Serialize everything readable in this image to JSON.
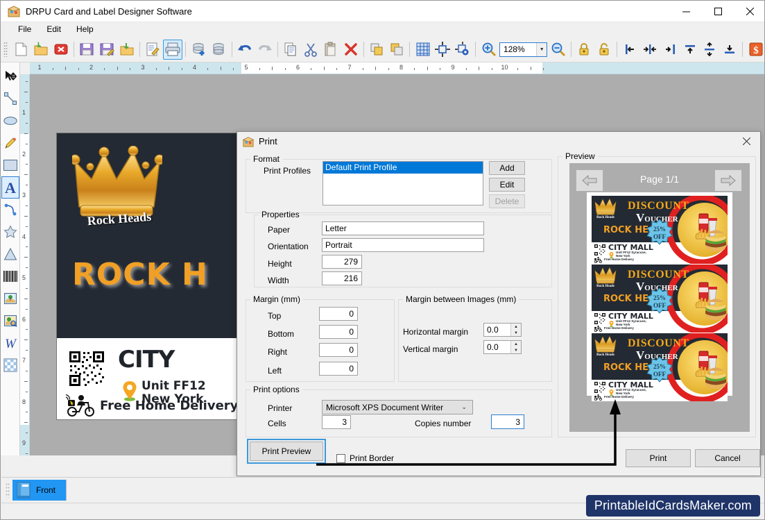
{
  "window": {
    "title": "DRPU Card and Label Designer Software",
    "app_icon": "card-designer-icon",
    "minimize": "—",
    "maximize": "☐",
    "close": "✕"
  },
  "menu": {
    "items": [
      {
        "label": "File",
        "mnemonic": "F"
      },
      {
        "label": "Edit",
        "mnemonic": "E"
      },
      {
        "label": "Help",
        "mnemonic": "H"
      }
    ]
  },
  "toolbar": {
    "zoom_value": "128%",
    "buttons": [
      {
        "name": "new-document-icon"
      },
      {
        "name": "open-folder-icon"
      },
      {
        "name": "close-document-icon"
      },
      {
        "name": "save-icon"
      },
      {
        "name": "save-as-icon"
      },
      {
        "name": "export-folder-icon"
      },
      {
        "name": "edit-document-icon"
      },
      {
        "name": "print-icon",
        "selected": true
      },
      {
        "name": "database-add-icon"
      },
      {
        "name": "database-icon"
      },
      {
        "name": "undo-icon"
      },
      {
        "name": "redo-icon"
      },
      {
        "name": "copy-icon"
      },
      {
        "name": "cut-icon"
      },
      {
        "name": "paste-icon"
      },
      {
        "name": "delete-icon"
      },
      {
        "name": "bring-to-front-icon"
      },
      {
        "name": "send-to-back-icon"
      },
      {
        "name": "grid-icon"
      },
      {
        "name": "align-center-object-icon"
      },
      {
        "name": "object-settings-icon"
      },
      {
        "name": "zoom-in-icon"
      },
      {
        "name": "zoom-out-icon"
      },
      {
        "name": "lock-icon"
      },
      {
        "name": "unlock-icon"
      },
      {
        "name": "align-left-icon"
      },
      {
        "name": "align-horizontal-center-icon"
      },
      {
        "name": "align-right-icon"
      },
      {
        "name": "align-top-icon"
      },
      {
        "name": "align-vertical-center-icon"
      },
      {
        "name": "align-bottom-icon"
      },
      {
        "name": "currency-icon"
      }
    ]
  },
  "left_tools": [
    {
      "name": "select-tool",
      "icon": "arrow-move-icon"
    },
    {
      "name": "line-tool",
      "icon": "line-icon"
    },
    {
      "name": "ellipse-tool",
      "icon": "ellipse-icon"
    },
    {
      "name": "pencil-tool",
      "icon": "pencil-icon"
    },
    {
      "name": "rectangle-tool",
      "icon": "rectangle-icon"
    },
    {
      "name": "text-tool",
      "icon": "text-a-icon",
      "selected": true
    },
    {
      "name": "curve-text-tool",
      "icon": "curve-text-icon"
    },
    {
      "name": "star-tool",
      "icon": "star-icon"
    },
    {
      "name": "triangle-tool",
      "icon": "triangle-icon"
    },
    {
      "name": "barcode-tool",
      "icon": "barcode-icon"
    },
    {
      "name": "image-tool",
      "icon": "picture-icon"
    },
    {
      "name": "image-browse-tool",
      "icon": "picture-search-icon"
    },
    {
      "name": "watermark-tool",
      "icon": "letter-w-icon"
    },
    {
      "name": "background-tool",
      "icon": "checker-icon"
    }
  ],
  "rulers": {
    "horizontal_labels": [
      "1",
      "2",
      "3",
      "4",
      "5",
      "6",
      "7",
      "8",
      "9",
      "10"
    ],
    "vertical_labels": [
      "1",
      "2",
      "3",
      "4",
      "5",
      "6",
      "7",
      "8",
      "9"
    ]
  },
  "canvas_card": {
    "logo_text": "Rock Heads",
    "headline": "ROCK H",
    "city": "CITY",
    "address_line1": "Unit FF12",
    "address_line2": "New York",
    "delivery": "Free Home Delivery"
  },
  "dialog": {
    "title": "Print",
    "icon": "print-dialog-icon",
    "close": "✕",
    "format": {
      "legend": "Format",
      "print_profiles_label": "Print Profiles",
      "profiles": [
        "Default Print Profile"
      ],
      "selected_profile": "Default Print Profile",
      "add_label": "Add",
      "edit_label": "Edit",
      "delete_label": "Delete"
    },
    "properties": {
      "legend": "Properties",
      "paper_label": "Paper",
      "paper_value": "Letter",
      "orientation_label": "Orientation",
      "orientation_value": "Portrait",
      "height_label": "Height",
      "height_value": "279",
      "width_label": "Width",
      "width_value": "216"
    },
    "margin": {
      "legend": "Margin (mm)",
      "top_label": "Top",
      "top_value": "0",
      "bottom_label": "Bottom",
      "bottom_value": "0",
      "right_label": "Right",
      "right_value": "0",
      "left_label": "Left",
      "left_value": "0"
    },
    "margin_images": {
      "legend": "Margin between Images (mm)",
      "horizontal_label": "Horizontal margin",
      "horizontal_value": "0.0",
      "vertical_label": "Vertical margin",
      "vertical_value": "0.0"
    },
    "print_options": {
      "legend": "Print options",
      "printer_label": "Printer",
      "printer_value": "Microsoft XPS Document Writer",
      "cells_label": "Cells",
      "cells_value": "3",
      "copies_label": "Copies number",
      "copies_value": "3"
    },
    "print_preview_label": "Print Preview",
    "print_border_label": "Print Border",
    "print_border_checked": false,
    "preview": {
      "legend": "Preview",
      "page_label": "Page 1/1",
      "prev_icon": "arrow-left-icon",
      "next_icon": "arrow-right-icon",
      "cards": [
        {
          "discount": "DISCOUNT",
          "voucher_v": "V",
          "voucher_rest": "OUCHER",
          "brand": "ROCK HEADS",
          "badge_top": "25%",
          "badge_bottom": "OFF",
          "mall": "CITY MALL",
          "addr1": "Unit FF12 Syracuse,",
          "addr2": "New York",
          "delivery": "Free Home Delivery"
        },
        {
          "discount": "DISCOUNT",
          "voucher_v": "V",
          "voucher_rest": "OUCHER",
          "brand": "ROCK HEADS",
          "badge_top": "25%",
          "badge_bottom": "OFF",
          "mall": "CITY MALL",
          "addr1": "Unit FF12 Syracuse,",
          "addr2": "New York",
          "delivery": "Free Home Delivery"
        },
        {
          "discount": "DISCOUNT",
          "voucher_v": "V",
          "voucher_rest": "OUCHER",
          "brand": "ROCK HEADS",
          "badge_top": "25%",
          "badge_bottom": "OFF",
          "mall": "CITY MALL",
          "addr1": "Unit FF12 Syracuse,",
          "addr2": "New York",
          "delivery": "Free Home Delivery"
        }
      ]
    },
    "print_label": "Print",
    "cancel_label": "Cancel"
  },
  "pages": {
    "front_tab": "Front",
    "front_icon": "page-book-icon"
  },
  "watermark": "PrintableIdCardsMaker.com",
  "colors": {
    "accent_blue": "#0078d7",
    "focus_blue": "#3c99dc",
    "canvas_gray": "#adadad",
    "card_dark": "#242a33",
    "brand_orange": "#f0a026",
    "watermark_navy": "#1f3468"
  }
}
